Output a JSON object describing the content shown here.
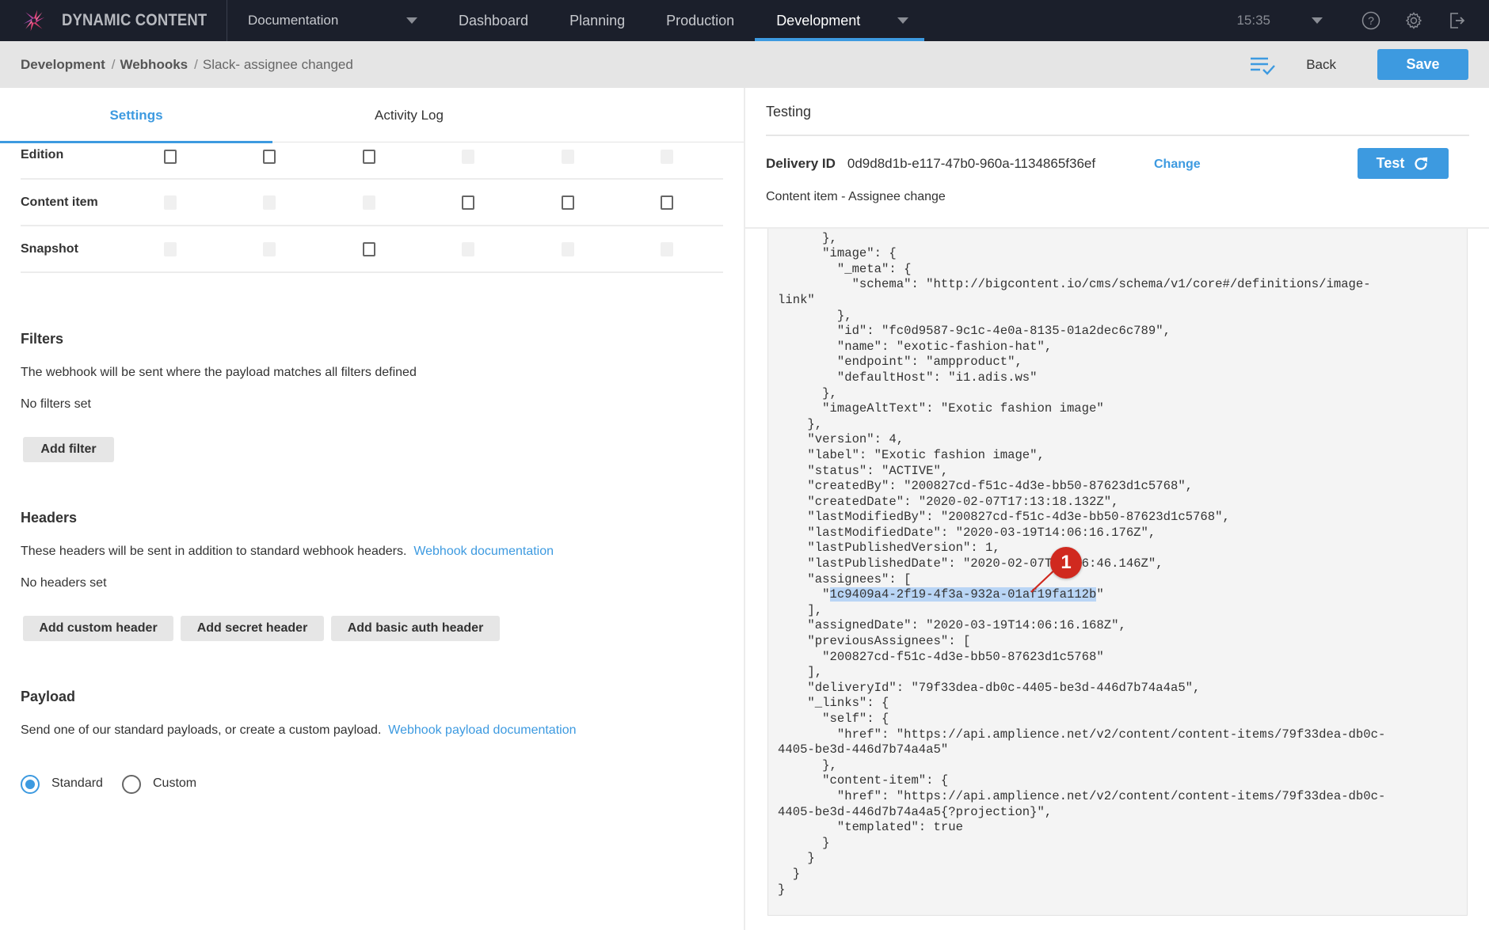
{
  "topnav": {
    "brand": "DYNAMIC CONTENT",
    "hub": "Documentation",
    "items": [
      {
        "label": "Dashboard"
      },
      {
        "label": "Planning"
      },
      {
        "label": "Production"
      },
      {
        "label": "Development",
        "active": true
      }
    ],
    "clock": "15:35",
    "icons": [
      "help-icon",
      "settings-icon",
      "logout-icon"
    ]
  },
  "breadcrumb": {
    "items": [
      "Development",
      "Webhooks"
    ],
    "current": "Slack- assignee changed",
    "separator": "/"
  },
  "toolbar": {
    "back_label": "Back",
    "save_label": "Save"
  },
  "tabs": [
    {
      "label": "Settings",
      "active": true
    },
    {
      "label": "Activity Log",
      "active": false
    }
  ],
  "permissions": {
    "rows": [
      {
        "label": "Edition",
        "cells": [
          "on",
          "on",
          "on",
          "off",
          "off",
          "off"
        ]
      },
      {
        "label": "Content item",
        "cells": [
          "off",
          "off",
          "off",
          "on",
          "on",
          "on"
        ]
      },
      {
        "label": "Snapshot",
        "cells": [
          "off",
          "off",
          "on",
          "off",
          "off",
          "off"
        ]
      }
    ]
  },
  "filters": {
    "title": "Filters",
    "description": "The webhook will be sent where the payload matches all filters defined",
    "empty": "No filters set",
    "add_button": "Add filter"
  },
  "headers": {
    "title": "Headers",
    "description": "These headers will be sent in addition to standard webhook headers.",
    "link": "Webhook documentation",
    "empty": "No headers set",
    "buttons": [
      "Add custom header",
      "Add secret header",
      "Add basic auth header"
    ]
  },
  "payload": {
    "title": "Payload",
    "description": "Send one of our standard payloads, or create a custom payload.",
    "link": "Webhook payload documentation",
    "options": [
      {
        "label": "Standard",
        "selected": true
      },
      {
        "label": "Custom",
        "selected": false
      }
    ]
  },
  "testing": {
    "title": "Testing",
    "delivery_label": "Delivery ID",
    "delivery_id": "0d9d8d1b-e117-47b0-960a-1134865f36ef",
    "change_label": "Change",
    "test_label": "Test",
    "event_name": "Content item - Assignee change",
    "code_before_highlight": "        \"schema\": \"http://www.example.com/simpleimage.json\"\n      },\n      \"image\": {\n        \"_meta\": {\n          \"schema\": \"http://bigcontent.io/cms/schema/v1/core#/definitions/image-\nlink\"\n        },\n        \"id\": \"fc0d9587-9c1c-4e0a-8135-01a2dec6c789\",\n        \"name\": \"exotic-fashion-hat\",\n        \"endpoint\": \"ampproduct\",\n        \"defaultHost\": \"i1.adis.ws\"\n      },\n      \"imageAltText\": \"Exotic fashion image\"\n    },\n    \"version\": 4,\n    \"label\": \"Exotic fashion image\",\n    \"status\": \"ACTIVE\",\n    \"createdBy\": \"200827cd-f51c-4d3e-bb50-87623d1c5768\",\n    \"createdDate\": \"2020-02-07T17:13:18.132Z\",\n    \"lastModifiedBy\": \"200827cd-f51c-4d3e-bb50-87623d1c5768\",\n    \"lastModifiedDate\": \"2020-03-19T14:06:16.176Z\",\n    \"lastPublishedVersion\": 1,\n    \"lastPublishedDate\": \"2020-02-07T17:16:46.146Z\",\n    \"assignees\": [\n      \"",
    "code_highlight": "1c9409a4-2f19-4f3a-932a-01af19fa112b",
    "code_after_highlight": "\"\n    ],\n    \"assignedDate\": \"2020-03-19T14:06:16.168Z\",\n    \"previousAssignees\": [\n      \"200827cd-f51c-4d3e-bb50-87623d1c5768\"\n    ],\n    \"deliveryId\": \"79f33dea-db0c-4405-be3d-446d7b74a4a5\",\n    \"_links\": {\n      \"self\": {\n        \"href\": \"https://api.amplience.net/v2/content/content-items/79f33dea-db0c-\n4405-be3d-446d7b74a4a5\"\n      },\n      \"content-item\": {\n        \"href\": \"https://api.amplience.net/v2/content/content-items/79f33dea-db0c-\n4405-be3d-446d7b74a4a5{?projection}\",\n        \"templated\": true\n      }\n    }\n  }\n}"
  },
  "annotation": {
    "marker_label": "1",
    "color": "#d0291f"
  },
  "colors": {
    "accent": "#3d9ae0",
    "nav_bg": "#1b1f2b",
    "subbar_bg": "#e5e5e5",
    "highlight": "#b9d5f5"
  }
}
